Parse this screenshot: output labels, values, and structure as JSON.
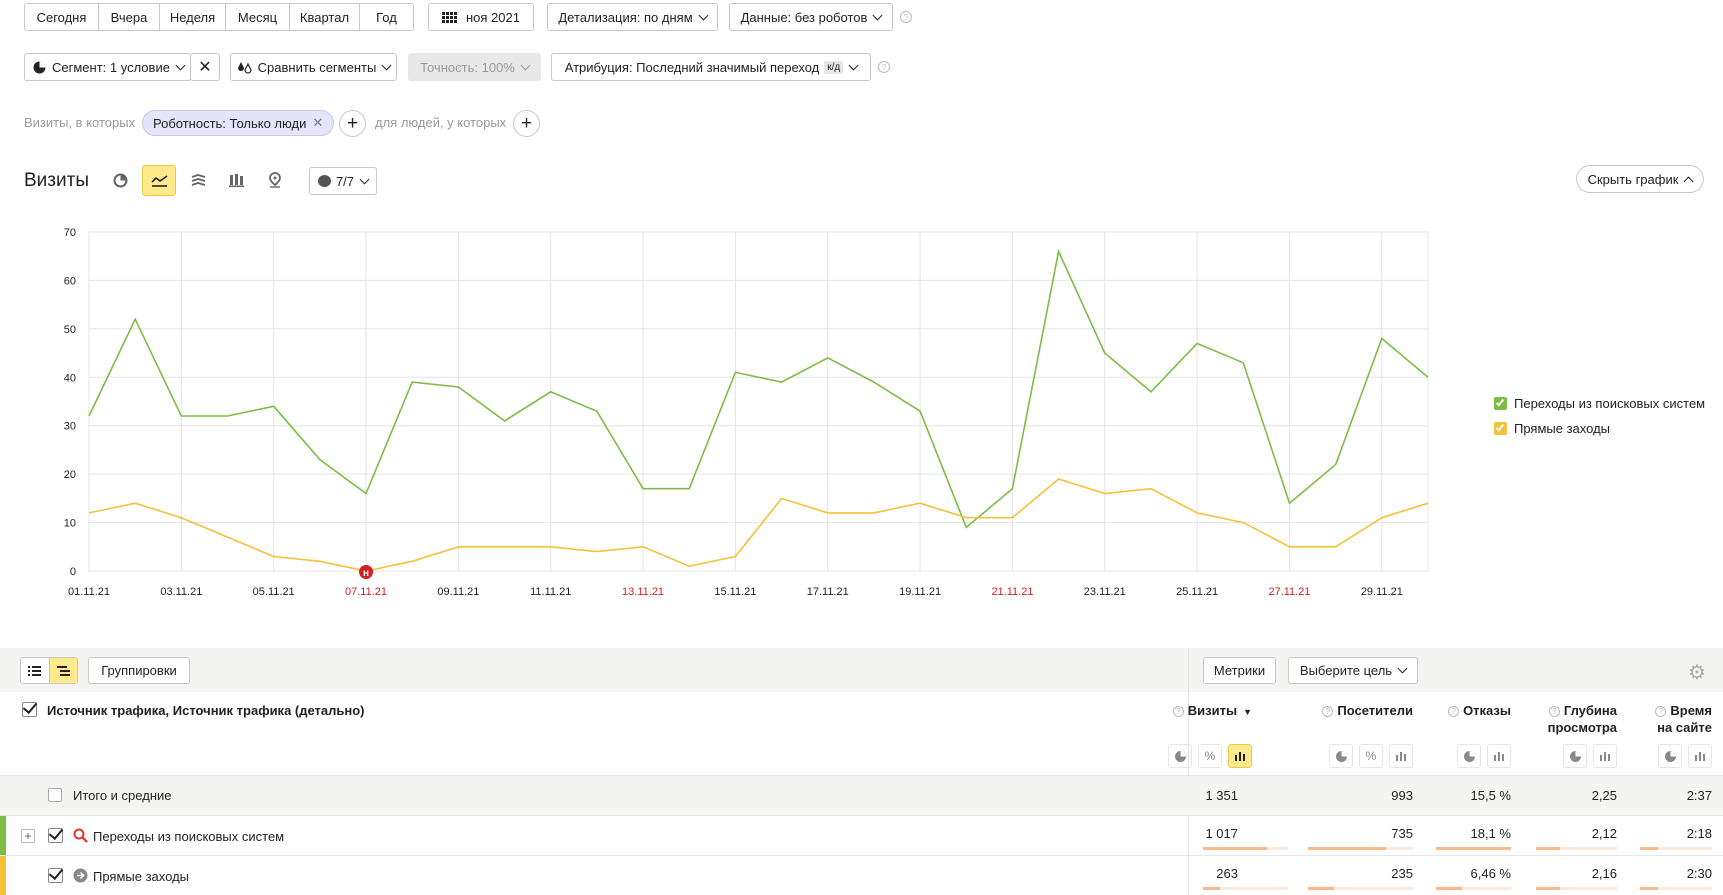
{
  "toolbar": {
    "periods": [
      "Сегодня",
      "Вчера",
      "Неделя",
      "Месяц",
      "Квартал",
      "Год"
    ],
    "date_label": "ноя 2021",
    "detail_label": "Детализация: по дням",
    "data_label": "Данные: без роботов",
    "segment_label": "Сегмент: 1 условие",
    "compare_label": "Сравнить сегменты",
    "accuracy_label": "Точность: 100%",
    "attribution_label": "Атрибуция: Последний значимый переход",
    "attribution_badge": "к/д"
  },
  "filter": {
    "visits_prefix": "Визиты, в которых",
    "chip_label": "Роботность: Только люди",
    "people_prefix": "для людей, у которых"
  },
  "chart_header": {
    "title": "Визиты",
    "notes_count": "7/7",
    "hide_label": "Скрыть график"
  },
  "chart_data": {
    "type": "line",
    "x": [
      "01.11.21",
      "02.11.21",
      "03.11.21",
      "04.11.21",
      "05.11.21",
      "06.11.21",
      "07.11.21",
      "08.11.21",
      "09.11.21",
      "10.11.21",
      "11.11.21",
      "12.11.21",
      "13.11.21",
      "14.11.21",
      "15.11.21",
      "16.11.21",
      "17.11.21",
      "18.11.21",
      "19.11.21",
      "20.11.21",
      "21.11.21",
      "22.11.21",
      "23.11.21",
      "24.11.21",
      "25.11.21",
      "26.11.21",
      "27.11.21",
      "28.11.21",
      "29.11.21",
      "30.11.21"
    ],
    "tick_labels": [
      "01.11.21",
      "03.11.21",
      "05.11.21",
      "07.11.21",
      "09.11.21",
      "11.11.21",
      "13.11.21",
      "15.11.21",
      "17.11.21",
      "19.11.21",
      "21.11.21",
      "23.11.21",
      "25.11.21",
      "27.11.21",
      "29.11.21"
    ],
    "weekend_ticks": [
      "07.11.21",
      "13.11.21",
      "21.11.21",
      "27.11.21"
    ],
    "ylim": [
      0,
      70
    ],
    "yticks": [
      0,
      10,
      20,
      30,
      40,
      50,
      60,
      70
    ],
    "grid": true,
    "legend_position": "right",
    "marker": {
      "x": "07.11.21",
      "label": "н",
      "color": "#d42020"
    },
    "series": [
      {
        "name": "Переходы из поисковых систем",
        "color": "#7cbd46",
        "values": [
          32,
          52,
          32,
          32,
          34,
          23,
          16,
          39,
          38,
          31,
          37,
          33,
          17,
          17,
          41,
          39,
          44,
          39,
          33,
          9,
          17,
          66,
          45,
          37,
          47,
          43,
          14,
          22,
          48,
          40
        ]
      },
      {
        "name": "Прямые заходы",
        "color": "#f5c13a",
        "values": [
          12,
          14,
          11,
          7,
          3,
          2,
          0,
          2,
          5,
          5,
          5,
          4,
          5,
          1,
          3,
          15,
          12,
          12,
          14,
          11,
          11,
          19,
          16,
          17,
          12,
          10,
          5,
          5,
          11,
          14
        ]
      }
    ]
  },
  "table_toolbar": {
    "groupings_label": "Группировки",
    "metrics_label": "Метрики",
    "goal_label": "Выберите цель"
  },
  "table": {
    "dimension_header": "Источник трафика, Источник трафика (детально)",
    "columns": [
      {
        "label": "Визиты",
        "sorted": "▼"
      },
      {
        "label": "Посетители"
      },
      {
        "label": "Отказы"
      },
      {
        "label": "Глубина\nпросмотра"
      },
      {
        "label": "Время\nна сайте"
      }
    ],
    "totals": {
      "label": "Итого и средние",
      "values": [
        "1 351",
        "993",
        "15,5 %",
        "2,25",
        "2:37"
      ]
    },
    "rows": [
      {
        "label": "Переходы из поисковых систем",
        "color": "#7cbd46",
        "icon": "search-icon",
        "values": [
          "1 017",
          "735",
          "18,1 %",
          "2,12",
          "2:18"
        ],
        "shares": [
          0.75,
          0.74,
          1.0,
          0.3,
          0.25
        ]
      },
      {
        "label": "Прямые заходы",
        "color": "#f5c13a",
        "icon": "direct-arrow-icon",
        "values": [
          "263",
          "235",
          "6,46 %",
          "2,16",
          "2:30"
        ],
        "shares": [
          0.2,
          0.25,
          0.35,
          0.3,
          0.25
        ]
      }
    ]
  }
}
